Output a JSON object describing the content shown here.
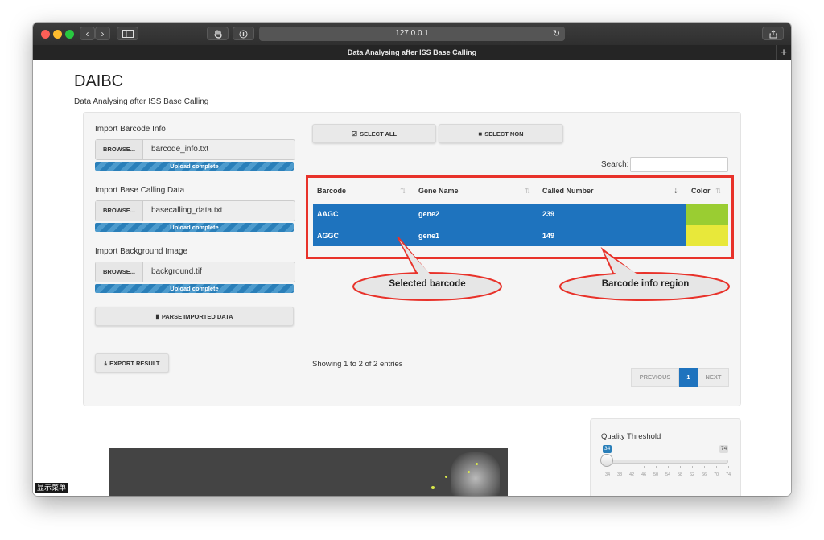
{
  "browser": {
    "url": "127.0.0.1",
    "tab_title": "Data Analysing after ISS Base Calling",
    "new_tab_label": "+",
    "nav_back": "‹",
    "nav_forward": "›"
  },
  "app": {
    "title": "DAIBC",
    "subtitle": "Data Analysing after ISS Base Calling"
  },
  "inputs": [
    {
      "label": "Import Barcode Info",
      "button": "BROWSE...",
      "filename": "barcode_info.txt",
      "status": "Upload complete",
      "progress": 1.0
    },
    {
      "label": "Import Base Calling Data",
      "button": "BROWSE...",
      "filename": "basecalling_data.txt",
      "status": "Upload complete",
      "progress": 1.0
    },
    {
      "label": "Import Background Image",
      "button": "BROWSE...",
      "filename": "background.tif",
      "status": "Upload complete",
      "progress": 1.0
    }
  ],
  "buttons": {
    "parse": "PARSE IMPORTED DATA",
    "export": "EXPORT RESULT",
    "select_all": "SELECT ALL",
    "select_none": "SELECT NON"
  },
  "search": {
    "label": "Search:",
    "value": ""
  },
  "table": {
    "headers": [
      "Barcode",
      "Gene Name",
      "Called Number",
      "Color"
    ],
    "rows": [
      {
        "barcode": "AAGC",
        "gene": "gene2",
        "called": "239",
        "color": "#9acd32"
      },
      {
        "barcode": "AGGC",
        "gene": "gene1",
        "called": "149",
        "color": "#e8e83a"
      }
    ],
    "row_selected_color": "#1e73be"
  },
  "annotations": {
    "selected": "Selected barcode",
    "info_region": "Barcode info region",
    "box_color": "#e8322a"
  },
  "footer": {
    "showing": "Showing 1 to 2 of 2 entries",
    "previous": "PREVIOUS",
    "page": "1",
    "next": "NEXT"
  },
  "quality": {
    "label": "Quality Threshold",
    "value": "34",
    "max": "74",
    "ticks": [
      "34",
      "38",
      "42",
      "46",
      "50",
      "54",
      "58",
      "62",
      "66",
      "70",
      "74"
    ]
  },
  "menu_label": "显示菜单",
  "colors": {
    "accent": "#2a7fb9",
    "traffic_red": "#fc5f57",
    "traffic_yellow": "#fdbc2e",
    "traffic_green": "#28c840"
  }
}
